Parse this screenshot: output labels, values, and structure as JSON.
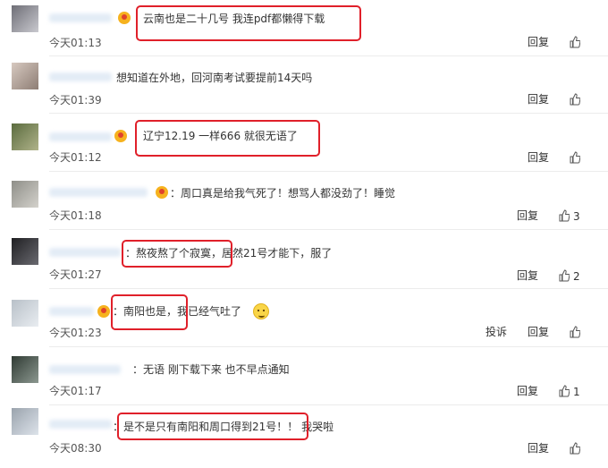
{
  "colors": {
    "highlight": "#e0202a",
    "divider": "#ececec",
    "crown": "#f6b21e"
  },
  "comments": [
    {
      "text": "云南也是二十几号 我连pdf都懒得下载",
      "time": "今天01:13",
      "reply_label": "回复",
      "likes": ""
    },
    {
      "text": "想知道在外地，回河南考试要提前14天吗",
      "time": "今天01:39",
      "reply_label": "回复",
      "likes": ""
    },
    {
      "text": "辽宁12.19 一样666 就很无语了",
      "time": "今天01:12",
      "reply_label": "回复",
      "likes": ""
    },
    {
      "text": "：周口真是给我气死了！想骂人都没劲了！睡觉",
      "time": "今天01:18",
      "reply_label": "回复",
      "likes": "3"
    },
    {
      "text": "：熬夜熬了个寂寞，居然21号才能下，服了",
      "time": "今天01:27",
      "reply_label": "回复",
      "likes": "2"
    },
    {
      "text": "：南阳也是，我已经气吐了",
      "time": "今天01:23",
      "report_label": "投诉",
      "reply_label": "回复",
      "likes": ""
    },
    {
      "text": "：无语 刚下载下来 也不早点通知",
      "time": "今天01:17",
      "reply_label": "回复",
      "likes": "1"
    },
    {
      "text": "：是不是只有南阳和周口得到21号！！ 我哭啦",
      "time": "今天08:30",
      "reply_label": "回复",
      "likes": ""
    }
  ]
}
